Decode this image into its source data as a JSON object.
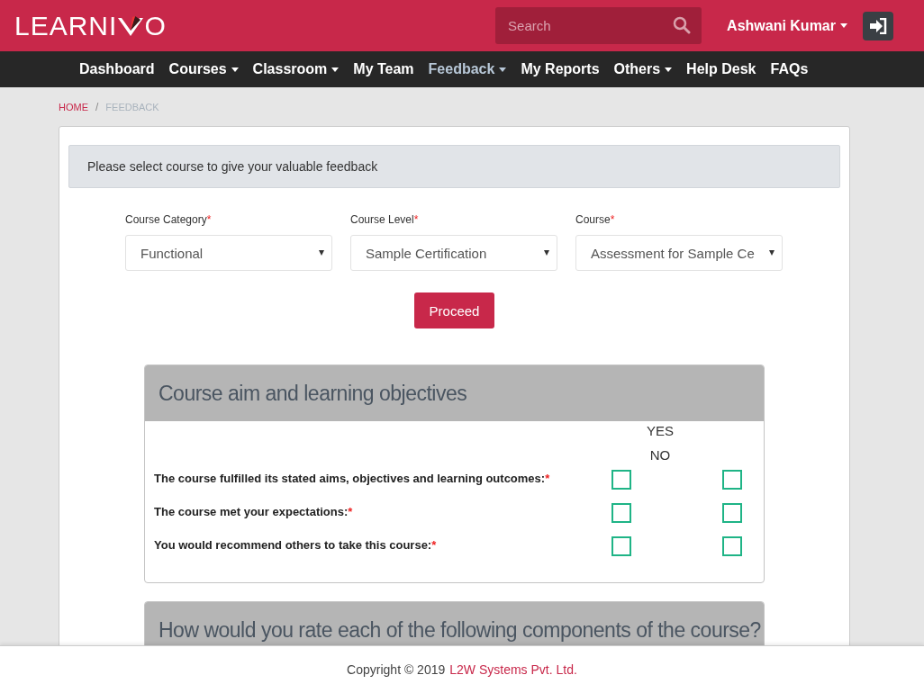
{
  "header": {
    "logo": {
      "before": "LEARNI",
      "after": "O"
    },
    "search": {
      "placeholder": "Search"
    },
    "user": {
      "name": "Ashwani Kumar"
    }
  },
  "nav": [
    {
      "label": "Dashboard",
      "dropdown": false,
      "selected": false
    },
    {
      "label": "Courses",
      "dropdown": true,
      "selected": false
    },
    {
      "label": "Classroom",
      "dropdown": true,
      "selected": false
    },
    {
      "label": "My Team",
      "dropdown": false,
      "selected": false
    },
    {
      "label": "Feedback",
      "dropdown": true,
      "selected": true
    },
    {
      "label": "My Reports",
      "dropdown": false,
      "selected": false
    },
    {
      "label": "Others",
      "dropdown": true,
      "selected": false
    },
    {
      "label": "Help Desk",
      "dropdown": false,
      "selected": false
    },
    {
      "label": "FAQs",
      "dropdown": false,
      "selected": false
    }
  ],
  "breadcrumb": [
    {
      "label": "HOME",
      "selected": false
    },
    {
      "separator": "/",
      "label": "FEEDBACK",
      "selected": true
    }
  ],
  "notice": "Please select course to give your valuable feedback",
  "selects": [
    {
      "label": "Course Category",
      "required_mark": "*",
      "value": "Functional"
    },
    {
      "label": "Course Level",
      "required_mark": "*",
      "value": "Sample Certification"
    },
    {
      "label": "Course",
      "required_mark": "*",
      "value": "Assessment for Sample Ce"
    }
  ],
  "proceed_button": "Proceed",
  "sections": [
    {
      "title": "Course aim and learning objectives",
      "columns": [
        "YES",
        "NO"
      ],
      "questions": [
        {
          "text": "The course fulfilled its stated aims, objectives and learning outcomes:",
          "required_mark": "*",
          "yes_checked": false,
          "no_checked": false
        },
        {
          "text": "The course met your expectations:",
          "required_mark": "*",
          "yes_checked": false,
          "no_checked": false
        },
        {
          "text": "You would recommend others to take this course:",
          "required_mark": "*",
          "yes_checked": false,
          "no_checked": false
        }
      ]
    },
    {
      "title": "How would you rate each of the following components of the course?"
    }
  ],
  "footer": {
    "text": "Copyright © 2019",
    "link": "L2W Systems Pvt. Ltd."
  }
}
